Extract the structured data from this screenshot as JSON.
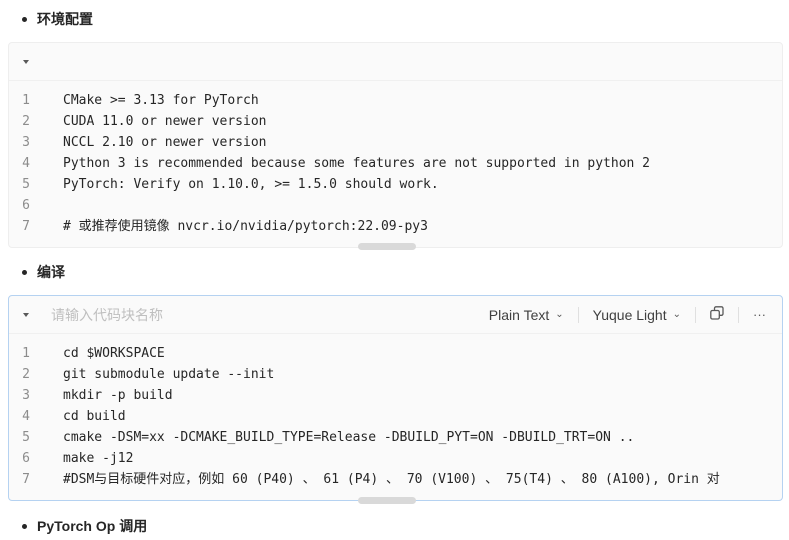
{
  "sections": {
    "env_title": "环境配置",
    "build_title": "编译",
    "op_title": "PyTorch Op 调用"
  },
  "block1": {
    "lines": [
      {
        "n": "1",
        "text": "CMake >= 3.13 for PyTorch"
      },
      {
        "n": "2",
        "text": "CUDA 11.0 or newer version"
      },
      {
        "n": "3",
        "text": "NCCL 2.10 or newer version"
      },
      {
        "n": "4",
        "text": "Python 3 is recommended because some features are not supported in python 2"
      },
      {
        "n": "5",
        "text": "PyTorch: Verify on 1.10.0, >= 1.5.0 should work."
      },
      {
        "n": "6",
        "text": ""
      },
      {
        "n": "7",
        "text": "# 或推荐使用镜像 nvcr.io/nvidia/pytorch:22.09-py3"
      }
    ]
  },
  "block2": {
    "name_placeholder": "请输入代码块名称",
    "language": "Plain Text",
    "theme": "Yuque Light",
    "copy_icon": "copy-icon",
    "more_label": "···",
    "lines": [
      {
        "n": "1",
        "text": "cd $WORKSPACE"
      },
      {
        "n": "2",
        "text": "git submodule update --init"
      },
      {
        "n": "3",
        "text": "mkdir -p build"
      },
      {
        "n": "4",
        "text": "cd build"
      },
      {
        "n": "5",
        "text": "cmake -DSM=xx -DCMAKE_BUILD_TYPE=Release -DBUILD_PYT=ON -DBUILD_TRT=ON .."
      },
      {
        "n": "6",
        "text": "make -j12"
      },
      {
        "n": "7",
        "text": "#DSM与目标硬件对应，例如 60 (P40) 、 61 (P4) 、 70 (V100) 、 75(T4) 、 80 (A100), Orin 对"
      }
    ]
  }
}
